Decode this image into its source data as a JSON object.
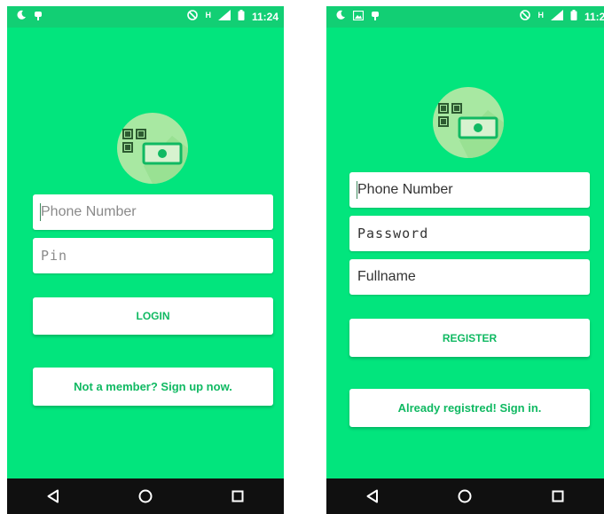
{
  "status_bar": {
    "time": "11:24",
    "network_label": "H",
    "icons": [
      "moon-icon",
      "android-debug-icon",
      "image-notification-icon",
      "do-not-disturb-icon",
      "signal-icon",
      "battery-icon"
    ]
  },
  "login_screen": {
    "phone_placeholder": "Phone Number",
    "pin_placeholder": "Pin",
    "login_label": "LOGIN",
    "signup_label": "Not a member? Sign up now."
  },
  "register_screen": {
    "phone_placeholder": "Phone Number",
    "password_placeholder": "Password",
    "fullname_placeholder": "Fullname",
    "register_label": "REGISTER",
    "signin_label": "Already registred! Sign in."
  },
  "nav_bar": {
    "icons": [
      "back-icon",
      "home-icon",
      "recents-icon"
    ]
  },
  "colors": {
    "background": "#02e57d",
    "status_bar": "#12cf74",
    "accent_text": "#10b962",
    "logo_circle": "#a8e8a2",
    "nav_bar": "#101010"
  }
}
